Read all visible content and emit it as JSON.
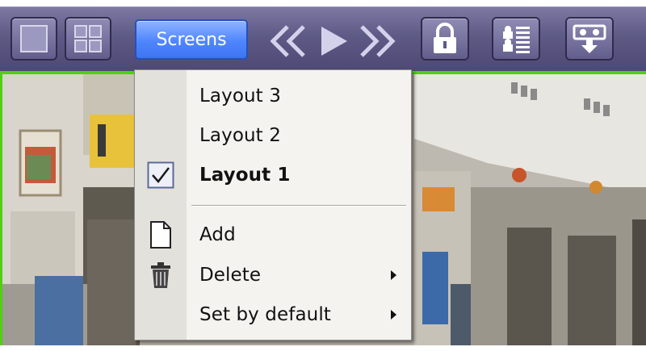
{
  "toolbar": {
    "screens_label": "Screens",
    "buttons": [
      {
        "icon": "single-view-icon"
      },
      {
        "icon": "grid-view-icon"
      },
      {
        "icon": "prev-layout-icon"
      },
      {
        "icon": "play-icon"
      },
      {
        "icon": "next-layout-icon"
      },
      {
        "icon": "lock-icon"
      },
      {
        "icon": "event-list-icon"
      },
      {
        "icon": "cassette-download-icon"
      }
    ],
    "colors": {
      "bar": "#5e5a86",
      "screens_button": "#4f86ff",
      "frame": "#4fd012"
    }
  },
  "menu": {
    "layouts": [
      {
        "label": "Layout 3",
        "checked": false
      },
      {
        "label": "Layout 2",
        "checked": false
      },
      {
        "label": "Layout 1",
        "checked": true
      }
    ],
    "actions": [
      {
        "label": "Add",
        "icon": "new-document-icon",
        "submenu": false
      },
      {
        "label": "Delete",
        "icon": "trash-icon",
        "submenu": true
      },
      {
        "label": "Set by default",
        "icon": "",
        "submenu": true
      }
    ]
  }
}
